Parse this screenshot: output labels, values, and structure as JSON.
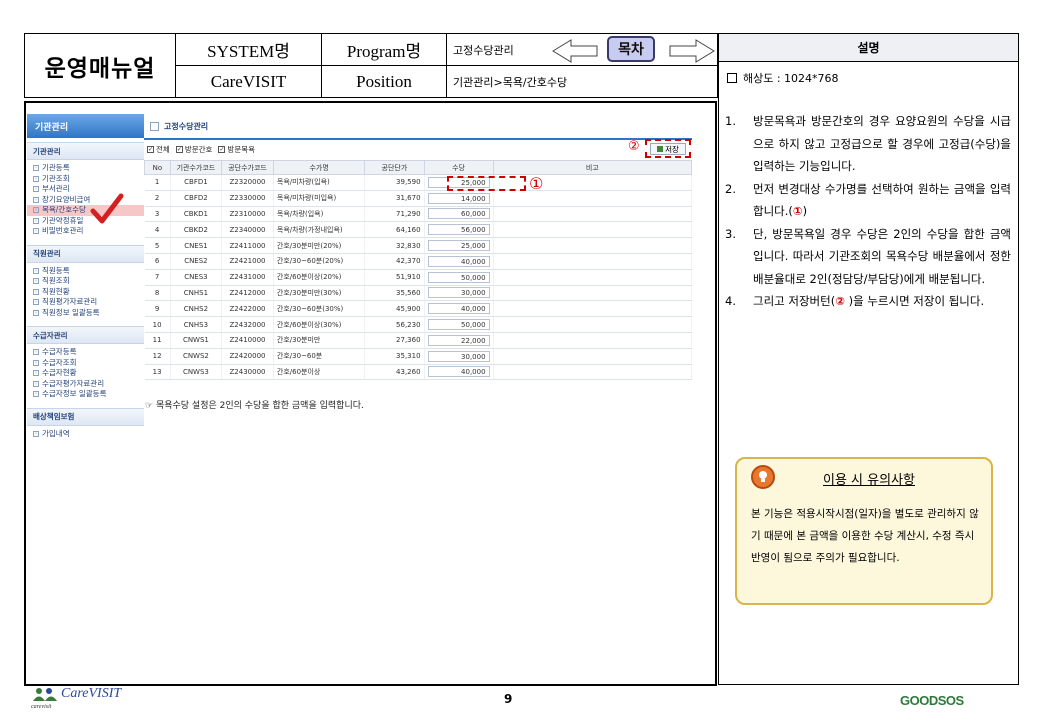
{
  "header": {
    "manual_title": "운영매뉴얼",
    "system_label": "SYSTEM명",
    "system_value": "CareVISIT",
    "program_label": "Program명",
    "position_label": "Position",
    "program_value": "고정수당관리",
    "position_value": "기관관리>목욕/간호수당",
    "toc_button": "목차"
  },
  "right_panel": {
    "title": "설명",
    "resolution": "해상도 : 1024*768",
    "steps": [
      {
        "num": "1.",
        "text": "방문목욕과 방문간호의 경우 요양요원의 수당을 시급으로 하지 않고 고정급으로 할 경우에 고정급(수당)을 입력하는 기능입니다."
      },
      {
        "num": "2.",
        "text_before": "먼저 변경대상 수가명를 선택하여 원하는 금액을 입력합니다.(",
        "mark": "①",
        "text_after": ")"
      },
      {
        "num": "3.",
        "text": "단, 방문목욕일 경우 수당은 2인의 수당을 합한 금액입니다. 따라서 기관조회의 목욕수당 배분율에서 정한 배분율대로 2인(정담당/부담당)에게 배분됩니다."
      },
      {
        "num": "4.",
        "text_before": "그리고 저장버턴(",
        "mark": "②",
        "text_after": " )을 누르시면 저장이 됩니다."
      }
    ],
    "notice": {
      "title": "이용 시 유의사항",
      "body": " 본 기능은 적용시작시점(일자)을 별도로 관리하지 않기 때문에 본 금액을 이용한 수당 계산시, 수정 즉시 반영이 됨으로 주의가 필요합니다."
    }
  },
  "screenshot": {
    "sidebar": {
      "top": "기관관리",
      "sections": [
        {
          "title": "기관관리",
          "items": [
            "기관등록",
            "기관조회",
            "부서관리",
            "장기요양비급여",
            "목욕/간호수당",
            "기관약정휴일",
            "비밀번호관리"
          ]
        },
        {
          "title": "직원관리",
          "items": [
            "직원등록",
            "직원조회",
            "직원현황",
            "직원평가자료관리",
            "직원정보 일괄등록"
          ]
        },
        {
          "title": "수급자관리",
          "items": [
            "수급자등록",
            "수급자조회",
            "수급자현황",
            "수급자평가자료관리",
            "수급자정보 일괄등록"
          ]
        },
        {
          "title": "배상책임보험",
          "items": [
            "가입내역"
          ]
        }
      ],
      "active_item": "목욕/간호수당"
    },
    "content_title": "고정수당관리",
    "filters": [
      "전체",
      "방문간호",
      "방문목욕"
    ],
    "save_label": "저장",
    "mark1": "①",
    "mark2": "②",
    "columns": [
      "No",
      "기관수가코드",
      "공단수가코드",
      "수가명",
      "공단단가",
      "수당",
      "비고"
    ],
    "rows": [
      [
        "1",
        "CBFD1",
        "Z2320000",
        "목욕/미차량(입욕)",
        "39,590",
        "25,000"
      ],
      [
        "2",
        "CBFD2",
        "Z2330000",
        "목욕/미차량(미입욕)",
        "31,670",
        "14,000"
      ],
      [
        "3",
        "CBKD1",
        "Z2310000",
        "목욕/차량(입욕)",
        "71,290",
        "60,000"
      ],
      [
        "4",
        "CBKD2",
        "Z2340000",
        "목욕/차량(가정내입욕)",
        "64,160",
        "56,000"
      ],
      [
        "5",
        "CNES1",
        "Z2411000",
        "간호/30분미만(20%)",
        "32,830",
        "25,000"
      ],
      [
        "6",
        "CNES2",
        "Z2421000",
        "간호/30~60분(20%)",
        "42,370",
        "40,000"
      ],
      [
        "7",
        "CNES3",
        "Z2431000",
        "간호/60분이상(20%)",
        "51,910",
        "50,000"
      ],
      [
        "8",
        "CNHS1",
        "Z2412000",
        "간호/30분미만(30%)",
        "35,560",
        "30,000"
      ],
      [
        "9",
        "CNHS2",
        "Z2422000",
        "간호/30~60분(30%)",
        "45,900",
        "40,000"
      ],
      [
        "10",
        "CNHS3",
        "Z2432000",
        "간호/60분이상(30%)",
        "56,230",
        "50,000"
      ],
      [
        "11",
        "CNWS1",
        "Z2410000",
        "간호/30분미만",
        "27,360",
        "22,000"
      ],
      [
        "12",
        "CNWS2",
        "Z2420000",
        "간호/30~60분",
        "35,310",
        "30,000"
      ],
      [
        "13",
        "CNWS3",
        "Z2430000",
        "간호/60분이상",
        "43,260",
        "40,000"
      ]
    ],
    "note": "목욕수당 설정은 2인의 수당을 합한 금액을 입력합니다."
  },
  "footer": {
    "left_brand": "CareVISIT",
    "left_sub": "carevisit",
    "page_number": "9",
    "right_brand": "GOODSOS"
  }
}
